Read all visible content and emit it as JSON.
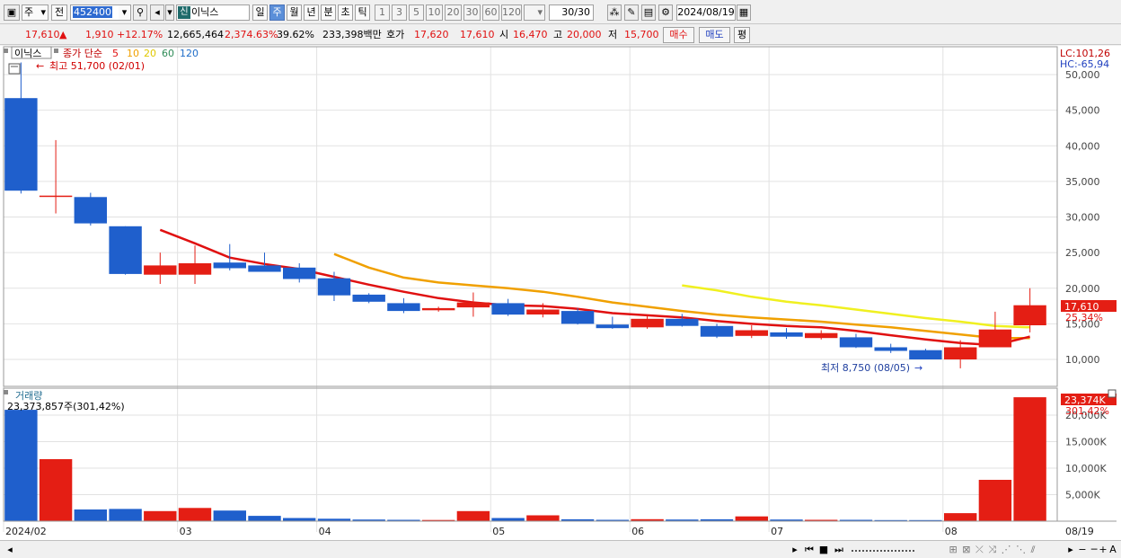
{
  "toolbar": {
    "period_type": "주",
    "prev_label": "전",
    "code": "452400",
    "stock_badge": "신",
    "stock_name": "이닉스",
    "periods": [
      "일",
      "주",
      "월",
      "년",
      "분",
      "초",
      "틱"
    ],
    "selected_period": "주",
    "intervals": [
      "1",
      "3",
      "5",
      "10",
      "20",
      "30",
      "60",
      "120"
    ],
    "count": "30/30",
    "date": "2024/08/19"
  },
  "info": {
    "price": "17,610",
    "change_arrow": "▲",
    "change": "1,910",
    "change_pct": "+12.17%",
    "volume": "12,665,464",
    "volume_pct": "2,374.63%",
    "turnover_pct": "39.62%",
    "amount": "233,398백만",
    "hoga_label": "호가",
    "hoga_ask": "17,620",
    "hoga_bid": "17,610",
    "open_label": "시",
    "open": "16,470",
    "high_label": "고",
    "high": "20,000",
    "low_label": "저",
    "low": "15,700",
    "buy_label": "매수",
    "sell_label": "매도",
    "pyeong_label": "평"
  },
  "legend": {
    "stock": "이닉스",
    "ma_label": "종가 단순",
    "ma_periods": [
      "5",
      "10",
      "20",
      "60",
      "120"
    ],
    "ma_colors": [
      "#e01010",
      "#f0a000",
      "#e0e000",
      "#2e8b57",
      "#1e6cc8"
    ],
    "max_note": "최고 51,700 (02/01)",
    "min_note": "최저 8,750 (08/05)",
    "lc": "LC:101,26",
    "hc": "HC:-65,94"
  },
  "price_axis": {
    "ticks": [
      "50,000",
      "45,000",
      "40,000",
      "35,000",
      "30,000",
      "25,000",
      "20,000",
      "15,000",
      "10,000"
    ],
    "current": "17,610",
    "current_pct": "25,34%"
  },
  "volume_panel": {
    "title": "거래량",
    "summary": "23,373,857주(301,42%)",
    "ticks": [
      "20,000K",
      "15,000K",
      "10,000K",
      "5,000K"
    ],
    "current": "23,374K",
    "current_pct": "301,42%"
  },
  "x_axis": {
    "labels": [
      "2024/02",
      "03",
      "04",
      "05",
      "06",
      "07",
      "08"
    ],
    "last_label": "08/19"
  },
  "chart_data": {
    "type": "candlestick",
    "weeks": [
      {
        "o": 46700,
        "h": 51700,
        "l": 33300,
        "c": 33700,
        "v": 21000000
      },
      {
        "o": 33000,
        "h": 40800,
        "l": 30500,
        "c": 33000,
        "v": 11700000
      },
      {
        "o": 32800,
        "h": 33400,
        "l": 28800,
        "c": 29100,
        "v": 2200000
      },
      {
        "o": 28700,
        "h": 28700,
        "l": 21900,
        "c": 22000,
        "v": 2300000
      },
      {
        "o": 21900,
        "h": 25000,
        "l": 20600,
        "c": 23200,
        "v": 1900000
      },
      {
        "o": 21900,
        "h": 26000,
        "l": 20600,
        "c": 23500,
        "v": 2500000
      },
      {
        "o": 23600,
        "h": 26200,
        "l": 22500,
        "c": 22800,
        "v": 2000000
      },
      {
        "o": 23200,
        "h": 25000,
        "l": 22500,
        "c": 22300,
        "v": 1000000
      },
      {
        "o": 22900,
        "h": 23500,
        "l": 20800,
        "c": 21300,
        "v": 600000
      },
      {
        "o": 21400,
        "h": 22300,
        "l": 18200,
        "c": 19000,
        "v": 450000
      },
      {
        "o": 19100,
        "h": 19300,
        "l": 17900,
        "c": 18100,
        "v": 300000
      },
      {
        "o": 17900,
        "h": 18600,
        "l": 16500,
        "c": 16800,
        "v": 250000
      },
      {
        "o": 16900,
        "h": 17400,
        "l": 16700,
        "c": 17200,
        "v": 220000
      },
      {
        "o": 17300,
        "h": 19400,
        "l": 16000,
        "c": 18000,
        "v": 1900000
      },
      {
        "o": 17900,
        "h": 18500,
        "l": 16100,
        "c": 16300,
        "v": 600000
      },
      {
        "o": 16300,
        "h": 17900,
        "l": 15900,
        "c": 17000,
        "v": 1100000
      },
      {
        "o": 16800,
        "h": 17200,
        "l": 14900,
        "c": 15000,
        "v": 350000
      },
      {
        "o": 14900,
        "h": 16000,
        "l": 14300,
        "c": 14400,
        "v": 250000
      },
      {
        "o": 14500,
        "h": 16100,
        "l": 14300,
        "c": 15700,
        "v": 380000
      },
      {
        "o": 15700,
        "h": 16400,
        "l": 14600,
        "c": 14700,
        "v": 300000
      },
      {
        "o": 14700,
        "h": 15000,
        "l": 13000,
        "c": 13200,
        "v": 350000
      },
      {
        "o": 13300,
        "h": 14800,
        "l": 13000,
        "c": 14100,
        "v": 900000
      },
      {
        "o": 13800,
        "h": 14400,
        "l": 12900,
        "c": 13200,
        "v": 300000
      },
      {
        "o": 13000,
        "h": 14100,
        "l": 12800,
        "c": 13700,
        "v": 250000
      },
      {
        "o": 13100,
        "h": 13600,
        "l": 11600,
        "c": 11700,
        "v": 250000
      },
      {
        "o": 11700,
        "h": 12200,
        "l": 10900,
        "c": 11200,
        "v": 200000
      },
      {
        "o": 11300,
        "h": 11500,
        "l": 10000,
        "c": 10000,
        "v": 200000
      },
      {
        "o": 10000,
        "h": 12700,
        "l": 8750,
        "c": 11700,
        "v": 1500000
      },
      {
        "o": 11700,
        "h": 16700,
        "l": 11700,
        "c": 14200,
        "v": 7800000
      },
      {
        "o": 14800,
        "h": 20000,
        "l": 13800,
        "c": 17610,
        "v": 23373857
      }
    ],
    "ma5": [
      null,
      null,
      null,
      null,
      28200,
      26300,
      24300,
      23400,
      22700,
      21600,
      20500,
      19500,
      18600,
      18000,
      17600,
      17500,
      17100,
      16500,
      16200,
      15900,
      15400,
      15000,
      14700,
      14500,
      14000,
      13400,
      12800,
      12300,
      12000,
      13200
    ],
    "ma10": [
      null,
      null,
      null,
      null,
      null,
      null,
      null,
      null,
      null,
      24800,
      22900,
      21500,
      20800,
      20400,
      20000,
      19500,
      18800,
      18000,
      17400,
      16800,
      16300,
      15900,
      15600,
      15300,
      14900,
      14500,
      14000,
      13500,
      13000,
      13000
    ],
    "ma20": [
      null,
      null,
      null,
      null,
      null,
      null,
      null,
      null,
      null,
      null,
      null,
      null,
      null,
      null,
      null,
      null,
      null,
      null,
      null,
      20400,
      19700,
      18800,
      18100,
      17600,
      17000,
      16400,
      15800,
      15300,
      14700,
      14500
    ],
    "ma_colors": {
      "ma5": "#e01010",
      "ma10": "#f0a000",
      "ma20": "#f0f020"
    },
    "price_ylim": [
      8000,
      52000
    ],
    "volume_ylim": [
      0,
      24000000
    ],
    "up_color": "#e41e14",
    "down_color": "#1f5fcc"
  }
}
